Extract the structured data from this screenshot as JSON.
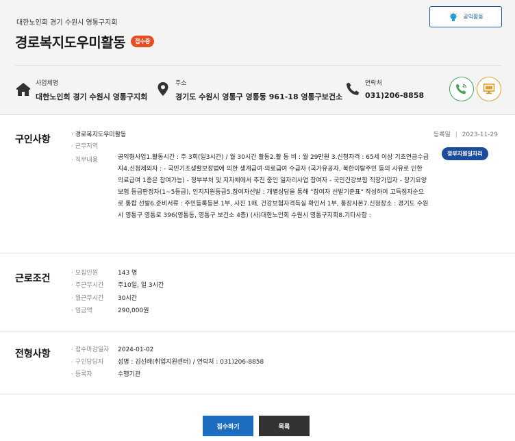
{
  "header": {
    "org": "대한노인회 경기 수원시 영통구지회",
    "title": "경로복지도우미활동",
    "status_badge": "접수중",
    "public_button": "공익활동"
  },
  "info": {
    "business": {
      "label": "사업체명",
      "value": "대한노인회 경기 수원시 영통구지회",
      "icon": "building-icon"
    },
    "address": {
      "label": "주소",
      "value": "경기도 수원시 영통구 영통동 961-18 영통구보건소",
      "icon": "location-pin-icon"
    },
    "contact": {
      "label": "연락처",
      "value": "031)206-8858",
      "icon": "phone-icon"
    }
  },
  "recruit": {
    "title": "구인사항",
    "reg_label": "등록일",
    "reg_date": "2023-11-29",
    "gov_badge": "정부지원일자리",
    "job_name": "경로복지도우미활동",
    "rows": [
      {
        "key": "근무지역",
        "value": ""
      },
      {
        "key": "직무내용",
        "value": ""
      }
    ],
    "description": "공익형사업1.활동시간 : 주 3회(일3시간) / 월 30시간 활동2.활 동 비 : 월 29만원 3.신청자격 : 65세 이상 기초연금수급자4.신청제외자 : - 국민기초생활보장법에 의한 생계급여·의료급여 수급자 (국가유공자, 북한이탈주민 등의 사유로 인한 의료급여 1종은 참여가능) - 정부부처 및 지자체에서 추진 중인 일자리사업 참여자 - 국민건강보험 직장가입자 - 장기요양보험 등급판정자(1~5등급), 인지지원등급5.참여자선발 : 개별상담을 통해 \"참여자 선발기준표\" 작성하여 고득점자순으로 통합 선발6.준비서류 : 주민등록등본 1부, 사진 1매, 건강보험자격득실 확인서 1부, 통장사본7.신청장소 : 경기도 수원시 영통구 영통로 396(영통동, 영통구 보건소 4층) (사)대한노인회 수원시 영통구지회8.기타사항 :"
  },
  "conditions": {
    "title": "근로조건",
    "rows": [
      {
        "key": "모집인원",
        "value": "143 명"
      },
      {
        "key": "주근무시간",
        "value": "주10일, 일 3시간"
      },
      {
        "key": "월근무시간",
        "value": "30시간"
      },
      {
        "key": "임금액",
        "value": "290,000원"
      }
    ]
  },
  "selection": {
    "title": "전형사항",
    "rows": [
      {
        "key": "접수마감일자",
        "value": "2024-01-02"
      },
      {
        "key": "구인담당자",
        "value": "성명 : 김선례(취업지원센터) / 연락처 : 031)206-8858"
      },
      {
        "key": "등록자",
        "value": "수행기관"
      }
    ]
  },
  "actions": {
    "apply": "접수하기",
    "list": "목록"
  },
  "colors": {
    "primary": "#1c6cc0",
    "navy": "#1c4b9c",
    "badge": "#e54d24",
    "dark_button": "#333333"
  }
}
